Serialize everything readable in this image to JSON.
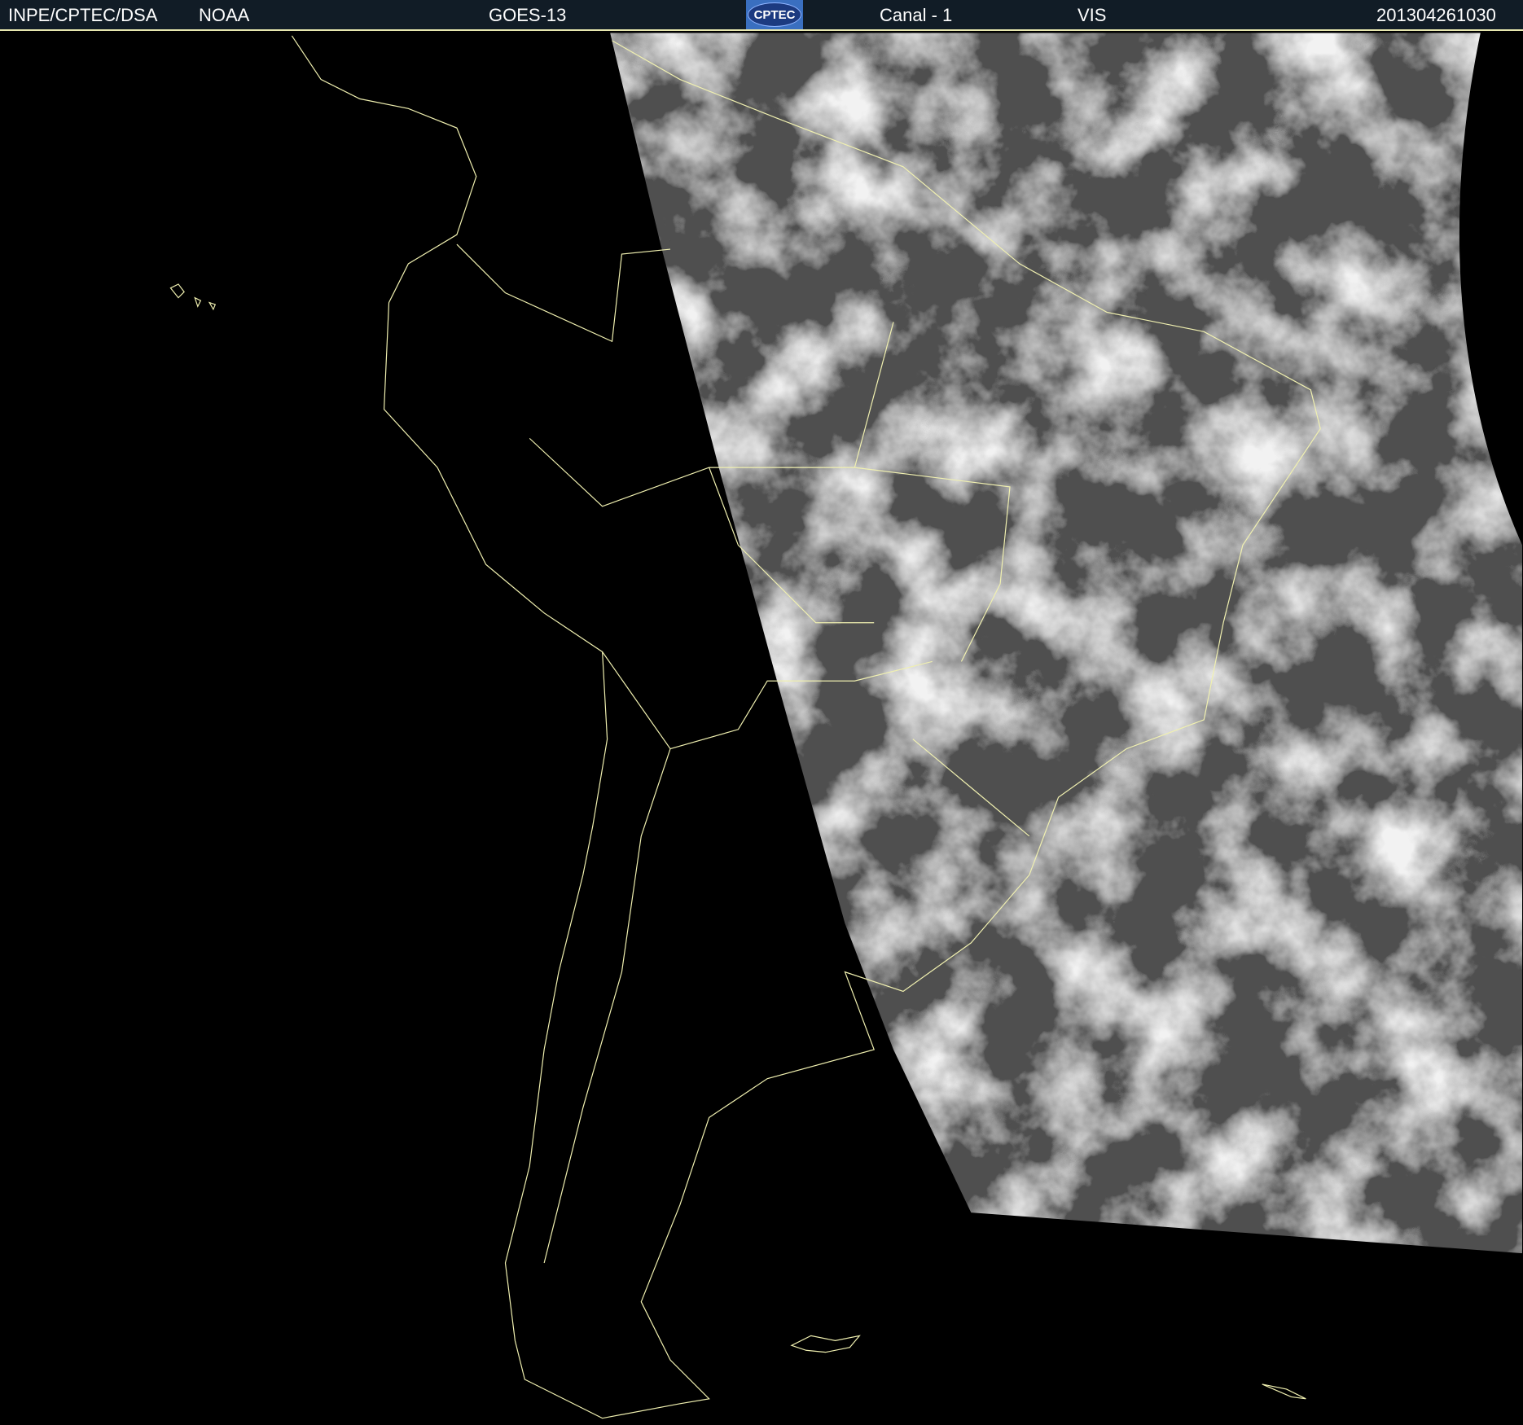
{
  "header": {
    "org": "INPE/CPTEC/DSA",
    "agency": "NOAA",
    "satellite": "GOES-13",
    "logo_text": "CPTEC",
    "channel": "Canal - 1",
    "band": "VIS",
    "timestamp": "201304261030"
  },
  "colors": {
    "header_bg": "#111c26",
    "coastline": "#f0f0b0",
    "background": "#000000"
  }
}
